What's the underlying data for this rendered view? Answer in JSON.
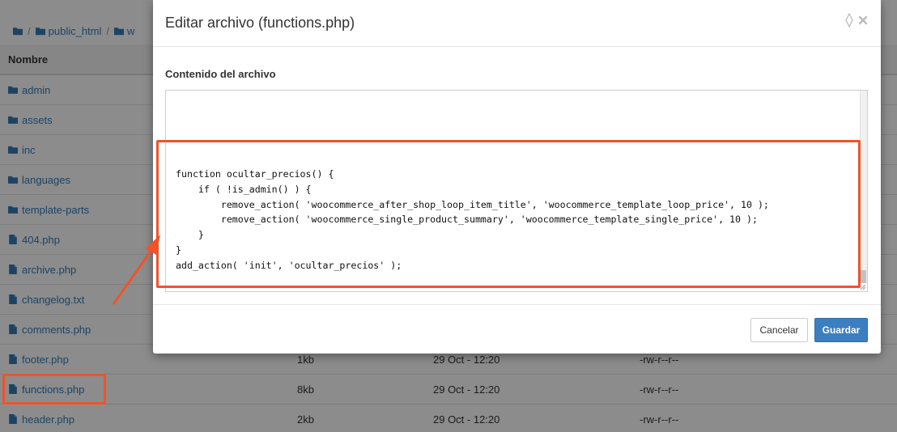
{
  "breadcrumb": {
    "items": [
      "",
      "public_html",
      "w"
    ]
  },
  "table": {
    "header_name": "Nombre",
    "rows": [
      {
        "name": "admin",
        "type": "folder",
        "size": "",
        "date": "",
        "perm": ""
      },
      {
        "name": "assets",
        "type": "folder",
        "size": "",
        "date": "",
        "perm": ""
      },
      {
        "name": "inc",
        "type": "folder",
        "size": "",
        "date": "",
        "perm": ""
      },
      {
        "name": "languages",
        "type": "folder",
        "size": "",
        "date": "",
        "perm": ""
      },
      {
        "name": "template-parts",
        "type": "folder",
        "size": "",
        "date": "",
        "perm": ""
      },
      {
        "name": "404.php",
        "type": "file",
        "size": "",
        "date": "",
        "perm": ""
      },
      {
        "name": "archive.php",
        "type": "file",
        "size": "",
        "date": "",
        "perm": ""
      },
      {
        "name": "changelog.txt",
        "type": "file",
        "size": "",
        "date": "",
        "perm": ""
      },
      {
        "name": "comments.php",
        "type": "file",
        "size": "",
        "date": "",
        "perm": ""
      },
      {
        "name": "footer.php",
        "type": "file",
        "size": "1kb",
        "date": "29 Oct - 12:20",
        "perm": "-rw-r--r--"
      },
      {
        "name": "functions.php",
        "type": "file",
        "size": "8kb",
        "date": "29 Oct - 12:20",
        "perm": "-rw-r--r--"
      },
      {
        "name": "header.php",
        "type": "file",
        "size": "2kb",
        "date": "29 Oct - 12:20",
        "perm": "-rw-r--r--"
      }
    ]
  },
  "modal": {
    "title": "Editar archivo (functions.php)",
    "field_label": "Contenido del archivo",
    "code": "function ocultar_precios() {\n    if ( !is_admin() ) {\n        remove_action( 'woocommerce_after_shop_loop_item_title', 'woocommerce_template_loop_price', 10 );\n        remove_action( 'woocommerce_single_product_summary', 'woocommerce_template_single_price', 10 );\n    }\n}\nadd_action( 'init', 'ocultar_precios' );",
    "cancel_label": "Cancelar",
    "save_label": "Guardar"
  },
  "colors": {
    "link": "#337ab7",
    "highlight": "#f0532a",
    "primary": "#3c7fc0"
  }
}
